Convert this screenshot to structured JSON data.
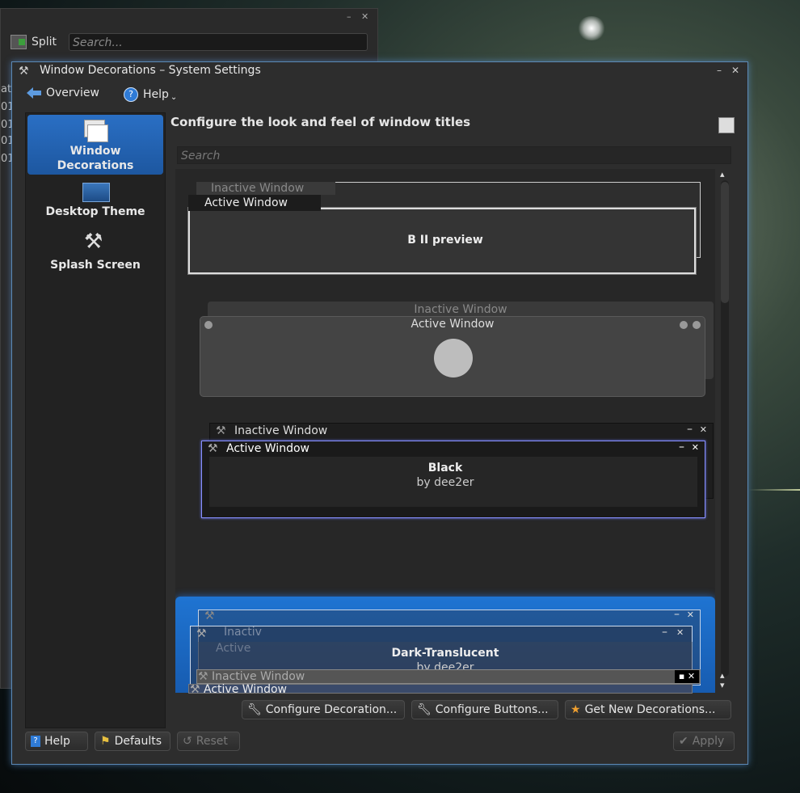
{
  "background_window": {
    "split_label": "Split",
    "search_placeholder": "Search...",
    "side_fragments": [
      "at",
      "01",
      "01",
      "01",
      "01"
    ]
  },
  "window": {
    "title": "Window Decorations – System Settings",
    "toolbar": {
      "overview_label": "Overview",
      "help_label": "Help"
    },
    "sidebar": {
      "items": [
        {
          "label": "Window Decorations",
          "icon": "window-decorations-icon",
          "active": true
        },
        {
          "label": "Desktop Theme",
          "icon": "desktop-theme-icon",
          "active": false
        },
        {
          "label": "Splash Screen",
          "icon": "splash-screen-icon",
          "active": false
        }
      ]
    },
    "heading": "Configure the look and feel of window titles",
    "search_placeholder": "Search",
    "decorations": [
      {
        "inactive_title": "Inactive Window",
        "active_title": "Active Window",
        "name": "B II preview",
        "author": ""
      },
      {
        "inactive_title": "Inactive Window",
        "active_title": "Active Window",
        "name": "",
        "author": ""
      },
      {
        "inactive_title": "Inactive Window",
        "active_title": "Active Window",
        "name": "Black",
        "author": "by dee2er"
      },
      {
        "inactive_title": "Inactiv",
        "active_title": "Active",
        "name": "Dark-Translucent",
        "author": "by dee2er",
        "selected": true
      },
      {
        "inactive_title": "Inactive Window",
        "active_title": "Active Window",
        "name": "",
        "author": ""
      }
    ],
    "action_buttons": {
      "configure_decoration": "Configure Decoration...",
      "configure_buttons": "Configure Buttons...",
      "get_new": "Get New Decorations..."
    },
    "footer_buttons": {
      "help": "Help",
      "defaults": "Defaults",
      "reset": "Reset",
      "apply": "Apply"
    },
    "colors": {
      "accent": "#1f6fc9",
      "selection": "#1a64c0",
      "window_bg": "#2d2d2d"
    }
  }
}
